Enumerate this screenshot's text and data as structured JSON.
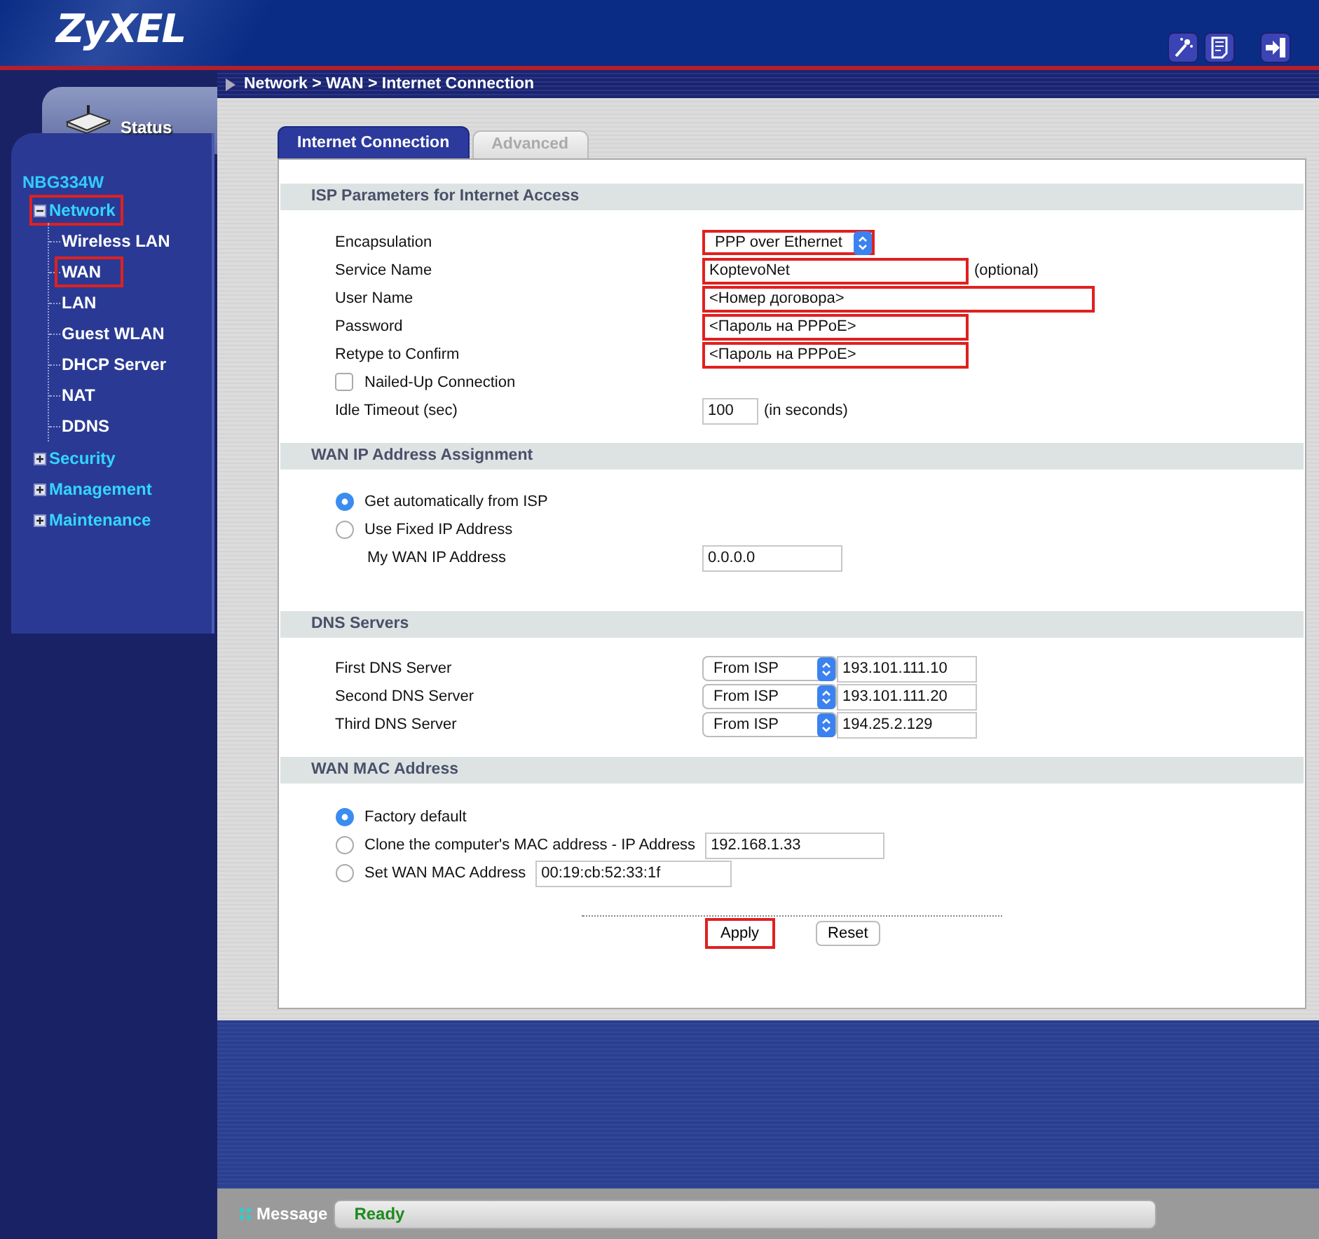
{
  "header": {
    "logo": "ZyXEL"
  },
  "sidebar": {
    "status_tab": "Status",
    "device": "NBG334W",
    "menu": [
      {
        "label": "Network",
        "expanded": true,
        "highlighted": true,
        "children": [
          {
            "label": "Wireless LAN",
            "highlighted": false
          },
          {
            "label": "WAN",
            "highlighted": true
          },
          {
            "label": "LAN",
            "highlighted": false
          },
          {
            "label": "Guest WLAN",
            "highlighted": false
          },
          {
            "label": "DHCP Server",
            "highlighted": false
          },
          {
            "label": "NAT",
            "highlighted": false
          },
          {
            "label": "DDNS",
            "highlighted": false
          }
        ]
      },
      {
        "label": "Security",
        "expanded": false,
        "highlighted": false
      },
      {
        "label": "Management",
        "expanded": false,
        "highlighted": false
      },
      {
        "label": "Maintenance",
        "expanded": false,
        "highlighted": false
      }
    ]
  },
  "breadcrumb": "Network > WAN > Internet Connection",
  "tabs": [
    {
      "label": "Internet Connection",
      "selected": true
    },
    {
      "label": "Advanced",
      "selected": false
    }
  ],
  "sections": [
    {
      "title": "ISP Parameters for Internet Access",
      "rows": [
        {
          "kind": "select",
          "label": "Encapsulation",
          "value": "PPP over Ethernet",
          "highlighted": true
        },
        {
          "kind": "text",
          "label": "Service Name",
          "value": "KoptevoNet",
          "wide": false,
          "note": "(optional)",
          "highlighted": true
        },
        {
          "kind": "text",
          "label": "User Name",
          "value": "<Номер договора>",
          "wide": true,
          "highlighted": true
        },
        {
          "kind": "text",
          "label": "Password",
          "value": "<Пароль на PPPoE>",
          "wide": false,
          "highlighted": true
        },
        {
          "kind": "text",
          "label": "Retype to Confirm",
          "value": "<Пароль на PPPoE>",
          "wide": false,
          "highlighted": true
        },
        {
          "kind": "checkbox",
          "label": "Nailed-Up Connection",
          "checked": false
        },
        {
          "kind": "text",
          "label": "Idle Timeout (sec)",
          "value": "100",
          "wide": false,
          "note": "(in seconds)",
          "highlighted": false
        }
      ]
    },
    {
      "title": "WAN IP Address Assignment",
      "rows": [
        {
          "kind": "radio",
          "label": "Get automatically from ISP",
          "selected": true
        },
        {
          "kind": "radio",
          "label": "Use Fixed IP Address",
          "selected": false
        },
        {
          "kind": "text",
          "label": "My WAN IP Address",
          "value": "0.0.0.0",
          "wide": false,
          "sub": true,
          "highlighted": false
        }
      ]
    },
    {
      "title": "DNS Servers",
      "rows": [
        {
          "kind": "select_text",
          "label": "First DNS Server",
          "option": "From ISP",
          "value": "193.101.111.10"
        },
        {
          "kind": "select_text",
          "label": "Second DNS Server",
          "option": "From ISP",
          "value": "193.101.111.20"
        },
        {
          "kind": "select_text",
          "label": "Third DNS Server",
          "option": "From ISP",
          "value": "194.25.2.129"
        }
      ]
    },
    {
      "title": "WAN MAC Address",
      "rows": [
        {
          "kind": "radio",
          "label": "Factory default",
          "selected": true
        },
        {
          "kind": "radio",
          "label": "Clone the computer's MAC address - IP Address",
          "selected": false,
          "value": "192.168.1.33"
        },
        {
          "kind": "radio",
          "label": "Set WAN MAC Address",
          "selected": false,
          "value": "00:19:cb:52:33:1f"
        }
      ]
    }
  ],
  "buttons": [
    {
      "label": "Apply",
      "highlighted": true
    },
    {
      "label": "Reset",
      "highlighted": false
    }
  ],
  "status_bar": {
    "label": "Message",
    "text": "Ready"
  }
}
